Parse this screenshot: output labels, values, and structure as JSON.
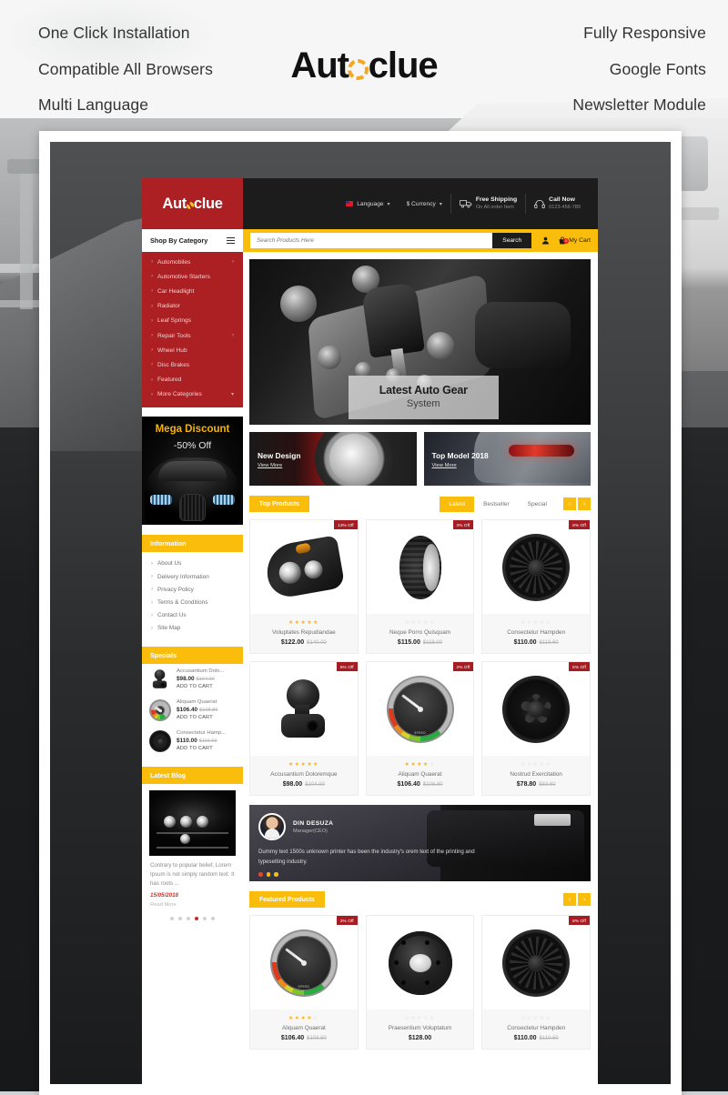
{
  "hero": {
    "left_features": [
      "One Click Installation",
      "Compatible All Browsers",
      "Multi Language"
    ],
    "right_features": [
      "Fully Responsive",
      "Google Fonts",
      "Newsletter Module"
    ],
    "logo_pre": "Aut",
    "logo_post": "clue"
  },
  "site": {
    "brand": {
      "pre": "Aut",
      "post": "clue"
    },
    "topbar": {
      "language": "Language",
      "currency": "$ Currency",
      "shipping_title": "Free Shipping",
      "shipping_sub": "On All order Item",
      "call_title": "Call Now",
      "call_sub": "0123-456-789"
    },
    "search": {
      "category_label": "Shop By Category",
      "placeholder": "Search Products Here",
      "button": "Search",
      "cart_label": "My Cart",
      "cart_count": "0"
    },
    "categories": [
      {
        "label": "Automobiles",
        "has_sub": true
      },
      {
        "label": "Automotive Starters",
        "has_sub": false
      },
      {
        "label": "Car Headlight",
        "has_sub": false
      },
      {
        "label": "Radiator",
        "has_sub": false
      },
      {
        "label": "Leaf Springs",
        "has_sub": false
      },
      {
        "label": "Repair Tools",
        "has_sub": true
      },
      {
        "label": "Wheel Hub",
        "has_sub": false
      },
      {
        "label": "Disc Brakes",
        "has_sub": false
      },
      {
        "label": "Featured",
        "has_sub": false
      },
      {
        "label": "More Categories",
        "has_sub": false
      }
    ],
    "side_banner": {
      "title": "Mega Discount",
      "subtitle": "-50% Off"
    },
    "information": {
      "heading": "Information",
      "links": [
        "About Us",
        "Delivery Information",
        "Privacy Policy",
        "Terms & Conditions",
        "Contact Us",
        "Site Map"
      ]
    },
    "specials": {
      "heading": "Specials",
      "items": [
        {
          "name": "Accusantium Dolo...",
          "price": "$98.00",
          "old_price": "$104.00",
          "cart": "ADD TO CART"
        },
        {
          "name": "Aliquam Quaerat",
          "price": "$106.40",
          "old_price": "$108.80",
          "cart": "ADD TO CART"
        },
        {
          "name": "Consectetur Hamp...",
          "price": "$110.00",
          "old_price": "$119.60",
          "cart": "ADD TO CART"
        }
      ]
    },
    "blog": {
      "heading": "Latest Blog",
      "excerpt": "Contrary to popular belief, Lorem Ipsum is not simply random text. It has roots ...",
      "date": "15/05/2018",
      "read_more": "Read More"
    },
    "slider": {
      "title": "Latest Auto Gear",
      "subtitle": "System"
    },
    "promos": [
      {
        "title": "New Design",
        "link": "View More"
      },
      {
        "title": "Top Model 2018",
        "link": "View More"
      }
    ],
    "top_products": {
      "heading": "Top Products",
      "tabs": [
        {
          "label": "Latest",
          "active": true
        },
        {
          "label": "Bestseller",
          "active": false
        },
        {
          "label": "Special",
          "active": false
        }
      ],
      "prev": "‹",
      "next": "›",
      "row1": [
        {
          "name": "Voluptates Repudiandae",
          "price": "$122.00",
          "old_price": "$140.00",
          "badge": "13% Off",
          "rating": 5,
          "art": "headlight"
        },
        {
          "name": "Neque Porro Quisquam",
          "price": "$115.00",
          "old_price": "$118.00",
          "badge": "3% Off",
          "rating": 0,
          "art": "tire"
        },
        {
          "name": "Consectetur Hampden",
          "price": "$110.00",
          "old_price": "$119.60",
          "badge": "8% Off",
          "rating": 0,
          "art": "rim"
        }
      ],
      "row2": [
        {
          "name": "Accusantium Doloremque",
          "price": "$98.00",
          "old_price": "$104.00",
          "badge": "6% Off",
          "rating": 5,
          "art": "knob"
        },
        {
          "name": "Aliquam Quaerat",
          "price": "$106.40",
          "old_price": "$108.80",
          "badge": "2% Off",
          "rating": 4,
          "art": "gauge"
        },
        {
          "name": "Nostrud Exercitation",
          "price": "$78.80",
          "old_price": "$83.60",
          "badge": "6% Off",
          "rating": 0,
          "art": "rim5"
        }
      ]
    },
    "testimonial": {
      "name": "DIN DESUZA",
      "role": "Manager(CEO)",
      "text": "Dummy text 1500s unknown printer has been the industry's orem text of the printing and typesetting industry."
    },
    "featured": {
      "heading": "Featured Products",
      "prev": "‹",
      "next": "›",
      "items": [
        {
          "name": "Aliquam Quaerat",
          "price": "$106.40",
          "old_price": "$108.80",
          "badge": "2% Off",
          "rating": 4,
          "art": "gauge"
        },
        {
          "name": "Praesentium Voluptatum",
          "price": "$128.00",
          "old_price": "",
          "badge": "",
          "rating": 0,
          "art": "hub"
        },
        {
          "name": "Consectetur Hampden",
          "price": "$110.00",
          "old_price": "$119.60",
          "badge": "8% Off",
          "rating": 0,
          "art": "rim"
        }
      ]
    }
  },
  "colors": {
    "brand_red": "#ac1f23",
    "accent_yellow": "#fbbd0b",
    "dark": "#1c1c1c",
    "badge_red": "#a51d22",
    "star_gold": "#fbb713",
    "date_red": "#d4322c"
  }
}
